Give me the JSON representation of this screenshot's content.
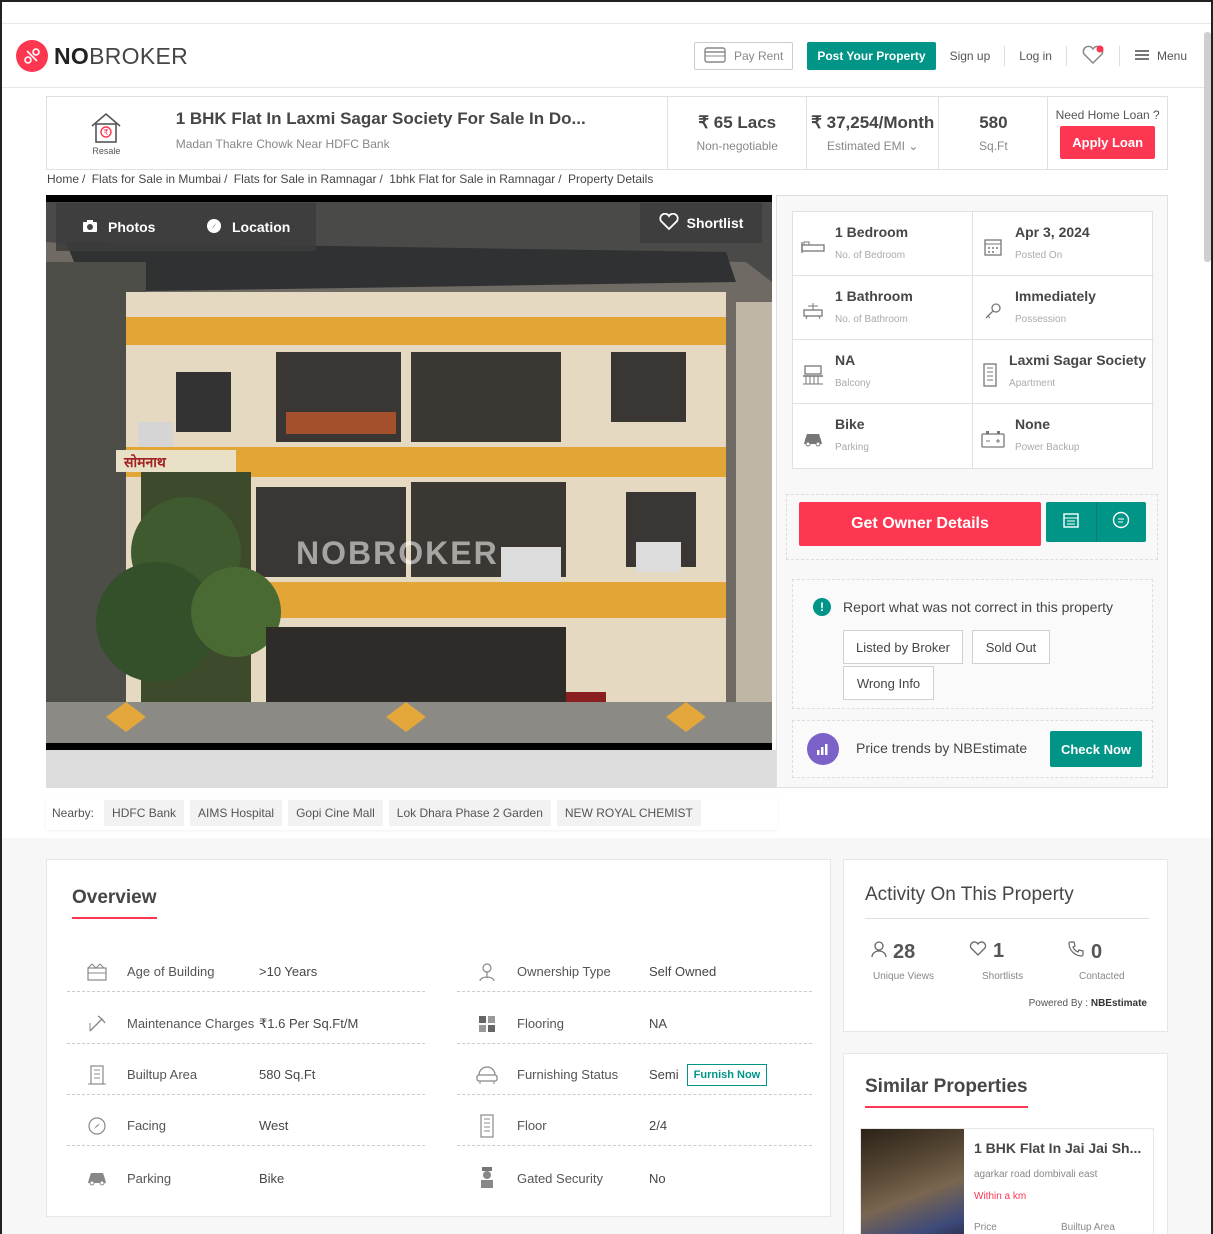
{
  "header": {
    "logo_bold": "NO",
    "logo_rest": "BROKER",
    "pay_rent": "Pay Rent",
    "post_property": "Post Your Property",
    "signup": "Sign up",
    "login": "Log in",
    "menu": "Menu"
  },
  "summary": {
    "resale_label": "Resale",
    "title": "1 BHK Flat In Laxmi Sagar Society For Sale In Do...",
    "address": "Madan Thakre Chowk Near HDFC Bank",
    "price": "₹ 65 Lacs",
    "price_note": "Non-negotiable",
    "emi": "₹ 37,254/Month",
    "emi_note": "Estimated EMI",
    "area": "580",
    "area_unit": "Sq.Ft",
    "loan_q": "Need Home Loan ?",
    "apply_loan": "Apply Loan"
  },
  "breadcrumb": [
    "Home",
    "/",
    "Flats for Sale in Mumbai",
    "/",
    "Flats for Sale in Ramnagar",
    "/",
    "1bhk Flat for Sale in Ramnagar",
    "/",
    "Property Details"
  ],
  "gallery": {
    "photos": "Photos",
    "location": "Location",
    "shortlist": "Shortlist",
    "watermark": "NOBROKER"
  },
  "specs": [
    {
      "icon": "bed-icon",
      "value": "1 Bedroom",
      "label": "No. of Bedroom"
    },
    {
      "icon": "calendar-icon",
      "value": "Apr 3, 2024",
      "label": "Posted On"
    },
    {
      "icon": "bath-icon",
      "value": "1 Bathroom",
      "label": "No. of Bathroom"
    },
    {
      "icon": "key-icon",
      "value": "Immediately",
      "label": "Possession"
    },
    {
      "icon": "balcony-icon",
      "value": "NA",
      "label": "Balcony"
    },
    {
      "icon": "building-icon",
      "value": "Laxmi Sagar Society",
      "label": "Apartment"
    },
    {
      "icon": "car-icon",
      "value": "Bike",
      "label": "Parking"
    },
    {
      "icon": "battery-icon",
      "value": "None",
      "label": "Power Backup"
    }
  ],
  "actions": {
    "owner_details": "Get Owner Details"
  },
  "report": {
    "heading": "Report what was not correct in this property",
    "tags": [
      "Listed by Broker",
      "Sold Out",
      "Wrong Info"
    ]
  },
  "price_trends": {
    "text": "Price trends by NBEstimate",
    "button": "Check Now"
  },
  "nearby": {
    "label": "Nearby:",
    "places": [
      "HDFC Bank",
      "AIMS Hospital",
      "Gopi Cine Mall",
      "Lok Dhara Phase 2 Garden",
      "NEW ROYAL CHEMIST"
    ]
  },
  "overview": {
    "title": "Overview",
    "left": [
      {
        "icon": "building-age-icon",
        "label": "Age of Building",
        "value": ">10 Years"
      },
      {
        "icon": "maintenance-icon",
        "label": "Maintenance Charges",
        "value": "₹1.6 Per Sq.Ft/M"
      },
      {
        "icon": "builtup-icon",
        "label": "Builtup Area",
        "value": "580 Sq.Ft"
      },
      {
        "icon": "compass-icon",
        "label": "Facing",
        "value": "West"
      },
      {
        "icon": "car-icon",
        "label": "Parking",
        "value": "Bike"
      }
    ],
    "right": [
      {
        "icon": "ownership-icon",
        "label": "Ownership Type",
        "value": "Self Owned"
      },
      {
        "icon": "flooring-icon",
        "label": "Flooring",
        "value": "NA"
      },
      {
        "icon": "sofa-icon",
        "label": "Furnishing Status",
        "value": "Semi"
      },
      {
        "icon": "floor-icon",
        "label": "Floor",
        "value": "2/4"
      },
      {
        "icon": "security-icon",
        "label": "Gated Security",
        "value": "No"
      }
    ],
    "furnish_now": "Furnish Now"
  },
  "activity": {
    "title": "Activity On This Property",
    "views": "28",
    "views_label": "Unique Views",
    "shortlists": "1",
    "shortlists_label": "Shortlists",
    "contacted": "0",
    "contacted_label": "Contacted",
    "powered_prefix": "Powered By :",
    "powered_by": "NBEstimate"
  },
  "similar": {
    "title": "Similar Properties",
    "item": {
      "name": "1 BHK Flat In Jai Jai Sh...",
      "address": "agarkar road dombivali east",
      "distance": "Within a km",
      "price_label": "Price",
      "area_label": "Builtup Area"
    }
  },
  "colors": {
    "brand_red": "#fd3752",
    "brand_green": "#009587"
  }
}
